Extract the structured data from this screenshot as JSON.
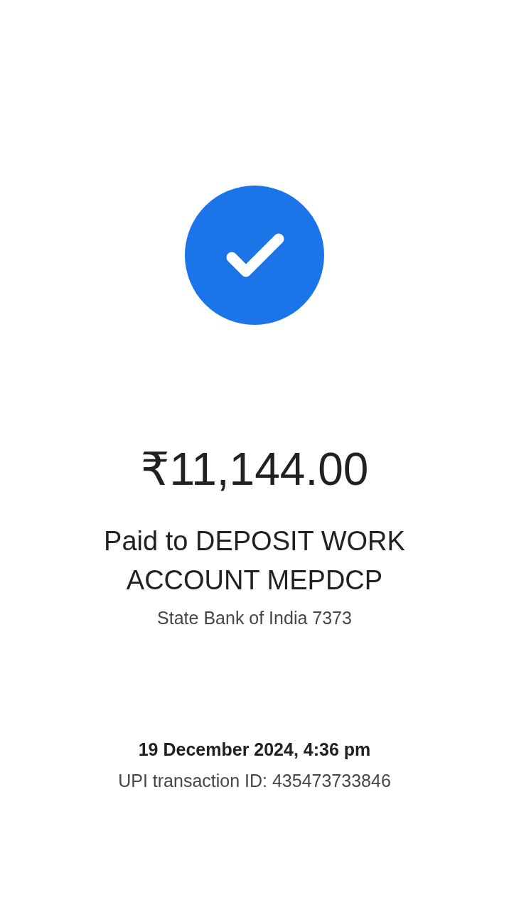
{
  "status": {
    "kind": "success"
  },
  "amount": "₹11,144.00",
  "payee": "Paid to DEPOSIT WORK ACCOUNT MEPDCP",
  "bank": "State Bank of India 7373",
  "datetime": "19 December 2024, 4:36 pm",
  "transaction_id": "UPI transaction ID: 435473733846"
}
